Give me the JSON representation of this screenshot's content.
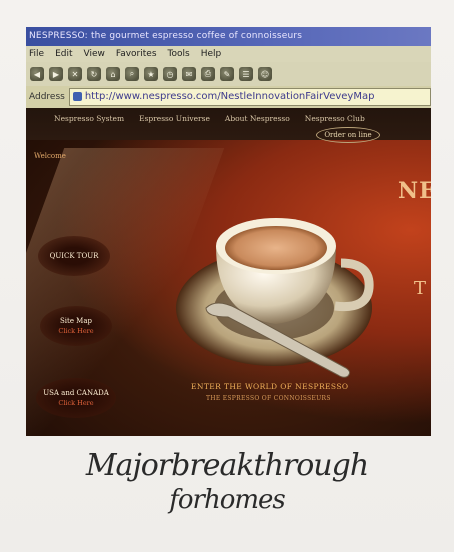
{
  "browser": {
    "window_title": "NESPRESSO: the gourmet espresso coffee of connoisseurs",
    "menu": [
      "File",
      "Edit",
      "View",
      "Favorites",
      "Tools",
      "Help"
    ],
    "address_label": "Address",
    "url": "http://www.nespresso.com/NestleInnovationFairVeveyMap"
  },
  "site": {
    "nav": [
      "Nespresso System",
      "Espresso Universe",
      "About Nespresso",
      "Nespresso Club"
    ],
    "order_button": "Order on line",
    "welcome": "Welcome",
    "quick_tour": "QUICK TOUR",
    "site_map": {
      "label": "Site Map",
      "sub": "Click Here"
    },
    "usa_canada": {
      "label": "USA and CANADA",
      "sub": "Click Here"
    },
    "brand_partial": "NE",
    "brand_partial_lower": "T",
    "tagline_main": "ENTER THE WORLD OF NESPRESSO",
    "tagline_sub": "THE ESPRESSO OF CONNOISSEURS"
  },
  "caption": {
    "line1": "Majorbreakthrough",
    "line2": "forhomes"
  }
}
